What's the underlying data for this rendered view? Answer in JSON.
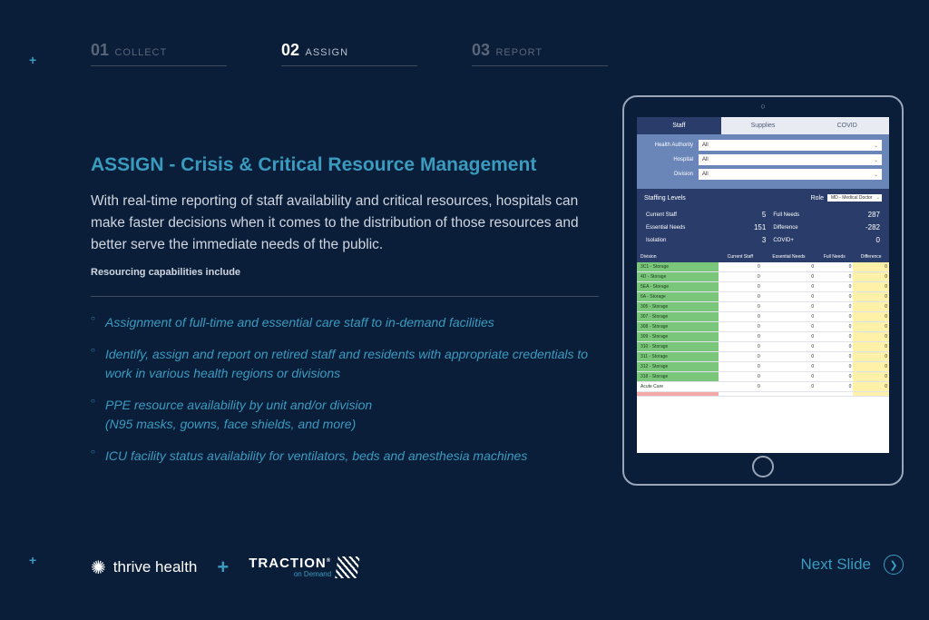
{
  "markers": {
    "plus": "+"
  },
  "steps": [
    {
      "num": "01",
      "label": "COLLECT",
      "active": false
    },
    {
      "num": "02",
      "label": "ASSIGN",
      "active": true
    },
    {
      "num": "03",
      "label": "REPORT",
      "active": false
    }
  ],
  "content": {
    "title": "ASSIGN - Crisis & Critical Resource Management",
    "description": "With real-time reporting of staff availability and critical resources, hospitals can make faster decisions when it comes to the distribution of those resources and better serve the immediate needs of the public.",
    "subhead": "Resourcing capabilities include",
    "bullets": [
      "Assignment of full-time and essential care staff to in-demand facilities",
      "Identify, assign and report on retired staff and residents with appropriate credentials to work in various health regions or divisions",
      "PPE resource availability by unit and/or division\n(N95 masks, gowns, face shields, and more)",
      "ICU facility status availability for ventilators, beds and anesthesia machines"
    ]
  },
  "logos": {
    "thrive": "thrive health",
    "plus": "+",
    "traction_main": "TRACTION",
    "traction_sub": "on Demand"
  },
  "next": {
    "label": "Next Slide"
  },
  "tablet": {
    "tabs": [
      "Staff",
      "Supplies",
      "COVID"
    ],
    "active_tab": 0,
    "filters": [
      {
        "label": "Health Authority",
        "value": "All"
      },
      {
        "label": "Hospital",
        "value": "All"
      },
      {
        "label": "Division",
        "value": "All"
      }
    ],
    "staffing_title": "Staffing Levels",
    "role_label": "Role",
    "role_value": "MD - Medical Doctor",
    "stats": [
      {
        "label": "Current Staff",
        "value": "5"
      },
      {
        "label": "Full Needs",
        "value": "287"
      },
      {
        "label": "Essential Needs",
        "value": "151"
      },
      {
        "label": "Difference",
        "value": "-282"
      },
      {
        "label": "Isolation",
        "value": "3"
      },
      {
        "label": "COVID+",
        "value": "0"
      }
    ],
    "grid_headers": [
      "Division",
      "Current Staff",
      "Essential Needs",
      "Full Needs",
      "Difference"
    ],
    "grid_rows": [
      {
        "div": "3C1 - Storage",
        "cs": "0",
        "en": "0",
        "fn": "0",
        "d": "0",
        "cls": ""
      },
      {
        "div": "4D - Storage",
        "cs": "0",
        "en": "0",
        "fn": "0",
        "d": "0",
        "cls": ""
      },
      {
        "div": "5EA - Storage",
        "cs": "0",
        "en": "0",
        "fn": "0",
        "d": "0",
        "cls": ""
      },
      {
        "div": "6A - Storage",
        "cs": "0",
        "en": "0",
        "fn": "0",
        "d": "0",
        "cls": ""
      },
      {
        "div": "305 - Storage",
        "cs": "0",
        "en": "0",
        "fn": "0",
        "d": "0",
        "cls": ""
      },
      {
        "div": "307 - Storage",
        "cs": "0",
        "en": "0",
        "fn": "0",
        "d": "0",
        "cls": ""
      },
      {
        "div": "308 - Storage",
        "cs": "0",
        "en": "0",
        "fn": "0",
        "d": "0",
        "cls": ""
      },
      {
        "div": "309 - Storage",
        "cs": "0",
        "en": "0",
        "fn": "0",
        "d": "0",
        "cls": ""
      },
      {
        "div": "310 - Storage",
        "cs": "0",
        "en": "0",
        "fn": "0",
        "d": "0",
        "cls": ""
      },
      {
        "div": "311 - Storage",
        "cs": "0",
        "en": "0",
        "fn": "0",
        "d": "0",
        "cls": ""
      },
      {
        "div": "312 - Storage",
        "cs": "0",
        "en": "0",
        "fn": "0",
        "d": "0",
        "cls": ""
      },
      {
        "div": "318 - Storage",
        "cs": "0",
        "en": "0",
        "fn": "0",
        "d": "0",
        "cls": ""
      },
      {
        "div": "Acute Care",
        "cs": "0",
        "en": "0",
        "fn": "0",
        "d": "0",
        "cls": "white"
      },
      {
        "div": "",
        "cs": "",
        "en": "",
        "fn": "",
        "d": "",
        "cls": "pink"
      }
    ]
  }
}
